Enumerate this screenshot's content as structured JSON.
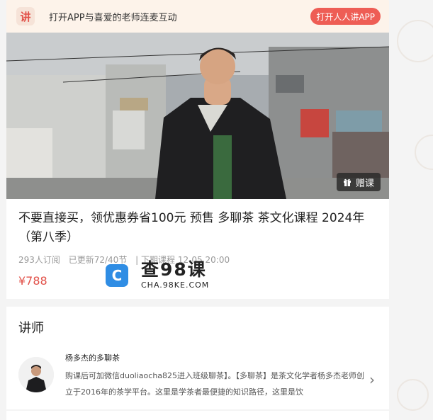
{
  "top_bar": {
    "logo_char": "讲",
    "prompt": "打开APP与喜爱的老师连麦互动",
    "open_button": "打开人人讲APP"
  },
  "hero": {
    "gift_button": "赠课",
    "gift_icon": "gift-icon"
  },
  "course": {
    "title": "不要直接买，领优惠券省100元 预售 多聊茶 茶文化课程 2024年（第八季）",
    "subscribers": "293人订阅",
    "updated": "已更新72/40节",
    "next_lesson": "| 下期课程 12-05 20:00",
    "price": "¥788"
  },
  "watermark": {
    "icon_char": "C",
    "main": "查98课",
    "sub": "CHA.98KE.COM"
  },
  "teacher": {
    "heading": "讲师",
    "name": "杨多杰的多聊茶",
    "description": "购课后可加微信duoliaocha825进入班级聊茶】。【多聊茶】是茶文化学者杨多杰老师创立于2016年的茶学平台。这里是学茶者最便捷的知识路径，这里是饮",
    "chevron": "›"
  },
  "colors": {
    "accent": "#ee5d55",
    "price": "#e2524a",
    "topbar_bg": "#fdf3ea",
    "watermark_blue": "#2f8de4"
  }
}
